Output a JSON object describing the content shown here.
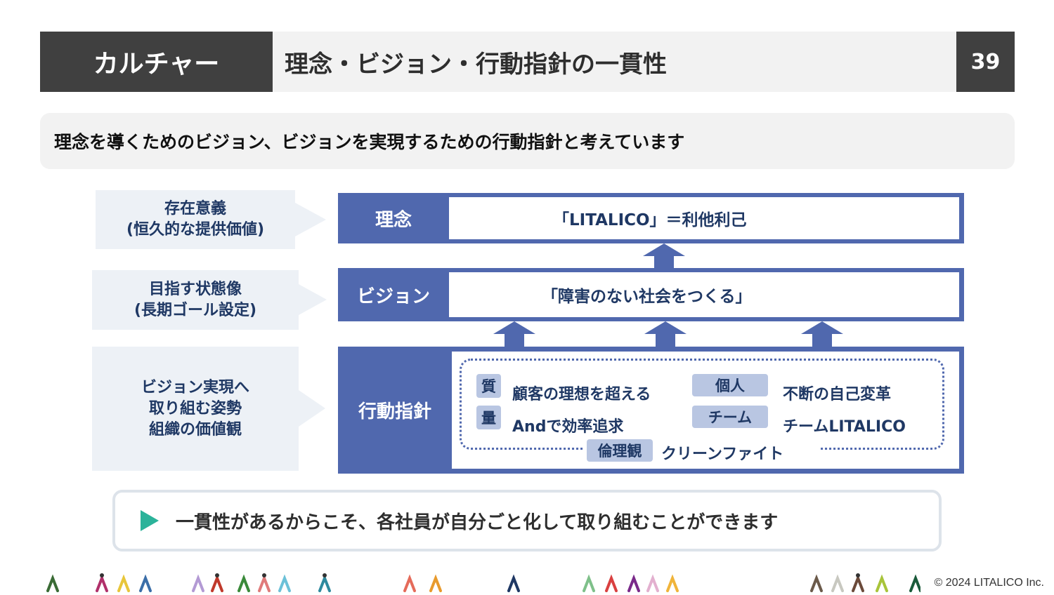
{
  "header": {
    "section": "カルチャー",
    "title": "理念・ビジョン・行動指針の一貫性",
    "page_number": "39"
  },
  "summary": "理念を導くためのビジョン、ビジョンを実現するための行動指針と考えています",
  "callouts": [
    {
      "line1": "存在意義",
      "line2": "(恒久的な提供価値)"
    },
    {
      "line1": "目指す状態像",
      "line2": "(長期ゴール設定)"
    },
    {
      "line1": "ビジョン実現へ",
      "line2": "取り組む姿勢",
      "line3": "組織の価値観"
    }
  ],
  "philosophy": {
    "label": "理念",
    "value": "「LITALICO」＝利他利己"
  },
  "vision": {
    "label": "ビジョン",
    "value": "「障害のない社会をつくる」"
  },
  "guidelines": {
    "label": "行動指針",
    "items": [
      {
        "tag": "質",
        "value": "顧客の理想を超える"
      },
      {
        "tag": "量",
        "value": "Andで効率追求"
      },
      {
        "tag": "個人",
        "value": "不断の自己変革"
      },
      {
        "tag": "チーム",
        "value": "チームLITALICO"
      }
    ],
    "ethics": {
      "tag": "倫理観",
      "value": "クリーンファイト"
    }
  },
  "conclusion": "一貫性があるからこそ、各社員が自分ごと化して取り組むことができます",
  "footer": "© 2024 LITALICO Inc.",
  "colors": {
    "dark": "#404040",
    "accent_blue": "#5068ae",
    "tag_blue": "#b9c6e2",
    "play_green": "#2bb39a"
  }
}
